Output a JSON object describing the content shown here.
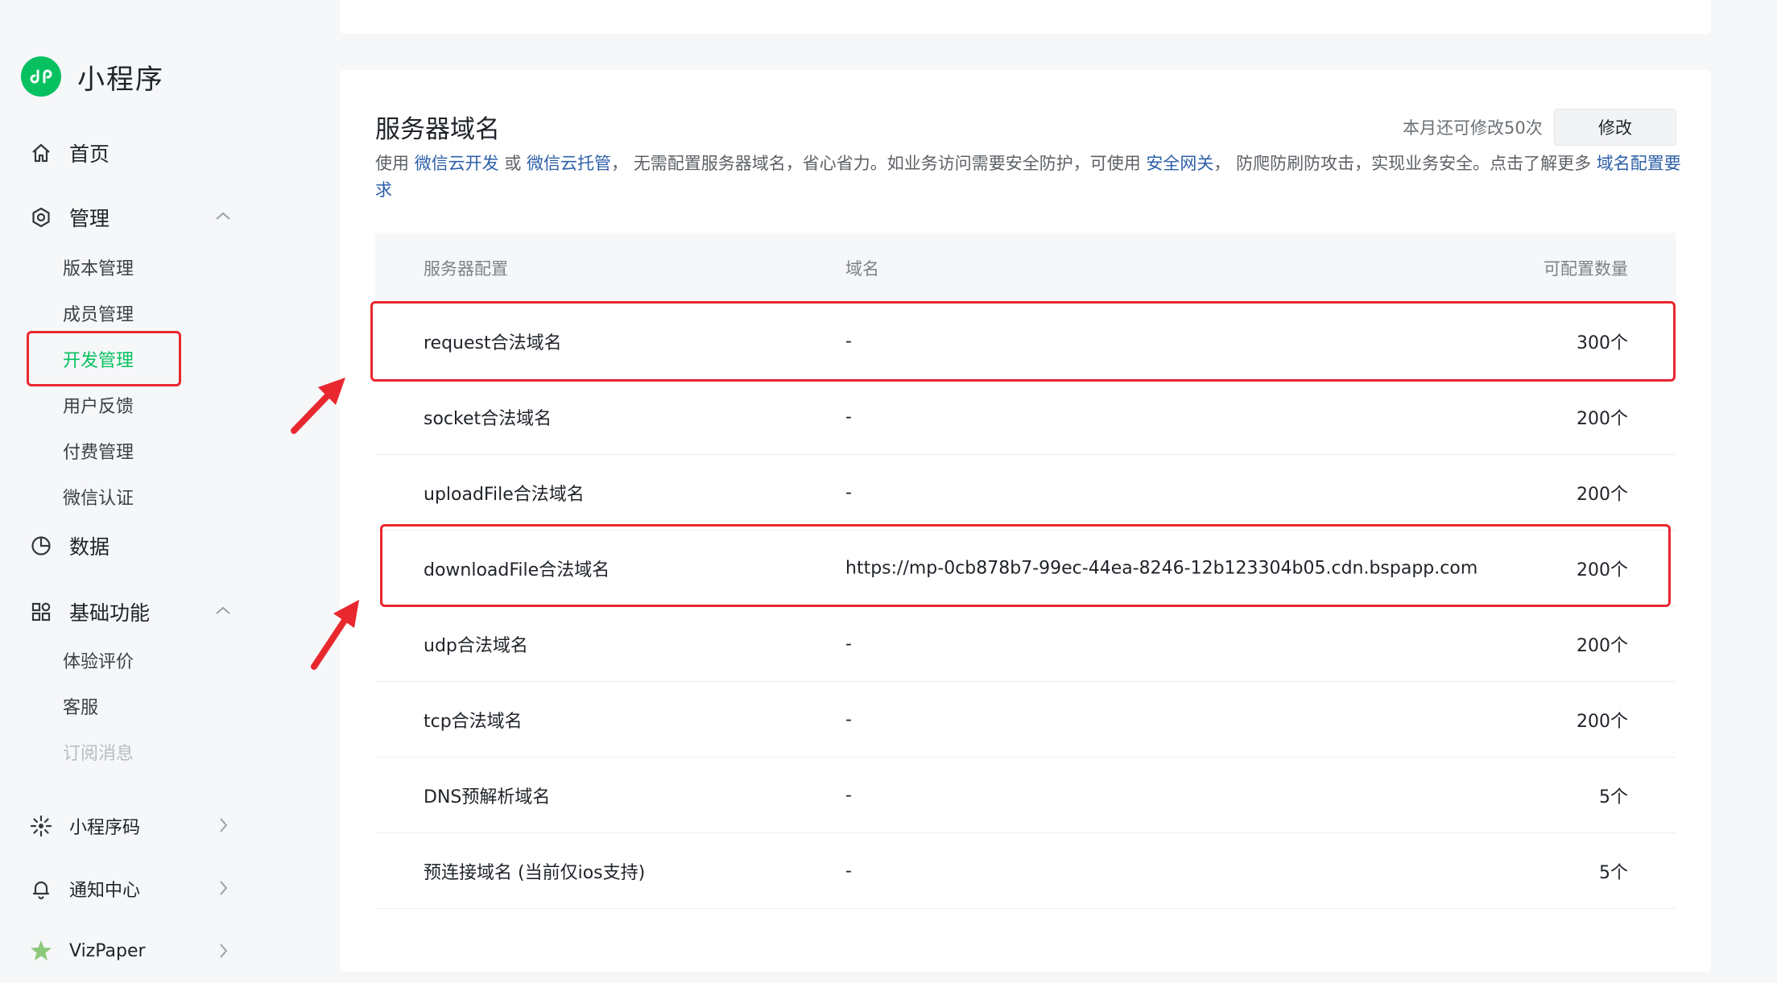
{
  "app": {
    "name": "小程序",
    "logo_icon": "mini-program-logo-icon",
    "accent": "#07c160"
  },
  "sidebar": {
    "home": {
      "label": "首页",
      "icon": "home-icon"
    },
    "manage": {
      "label": "管理",
      "icon": "settings-circle-icon",
      "items": [
        {
          "label": "版本管理",
          "state": "normal"
        },
        {
          "label": "成员管理",
          "state": "normal"
        },
        {
          "label": "开发管理",
          "state": "active"
        },
        {
          "label": "用户反馈",
          "state": "normal"
        },
        {
          "label": "付费管理",
          "state": "normal"
        },
        {
          "label": "微信认证",
          "state": "normal"
        }
      ]
    },
    "data": {
      "label": "数据",
      "icon": "pie-chart-icon"
    },
    "basic": {
      "label": "基础功能",
      "icon": "grid-icon",
      "items": [
        {
          "label": "体验评价",
          "state": "normal"
        },
        {
          "label": "客服",
          "state": "normal"
        },
        {
          "label": "订阅消息",
          "state": "disabled"
        }
      ]
    },
    "qrcode": {
      "label": "小程序码",
      "icon": "qrcode-icon"
    },
    "notify": {
      "label": "通知中心",
      "icon": "bell-icon"
    },
    "account": {
      "label": "VizPaper",
      "icon": "star-icon"
    }
  },
  "server_domain": {
    "title": "服务器域名",
    "quota_text": "本月还可修改50次",
    "modify_label": "修改",
    "desc": {
      "t1": "使用 ",
      "l1": "微信云开发",
      "t2": " 或 ",
      "l2": "微信云托管",
      "t3": "， 无需配置服务器域名，省心省力。如业务访问需要安全防护，可使用 ",
      "l3": "安全网关",
      "t4": "， 防爬防刷防攻击，实现业务安全。点击了解更多 ",
      "l4": "域名配置要求"
    },
    "columns": [
      "服务器配置",
      "域名",
      "可配置数量"
    ],
    "rows": [
      {
        "name": "request合法域名",
        "domain": "-",
        "count": "300个"
      },
      {
        "name": "socket合法域名",
        "domain": "-",
        "count": "200个"
      },
      {
        "name": "uploadFile合法域名",
        "domain": "-",
        "count": "200个"
      },
      {
        "name": "downloadFile合法域名",
        "domain": "https://mp-0cb878b7-99ec-44ea-8246-12b123304b05.cdn.bspapp.com",
        "count": "200个"
      },
      {
        "name": "udp合法域名",
        "domain": "-",
        "count": "200个"
      },
      {
        "name": "tcp合法域名",
        "domain": "-",
        "count": "200个"
      },
      {
        "name": "DNS预解析域名",
        "domain": "-",
        "count": "5个"
      },
      {
        "name": "预连接域名 (当前仅ios支持)",
        "domain": "-",
        "count": "5个"
      }
    ]
  },
  "annotations": {
    "highlight_color": "#e9272f"
  }
}
